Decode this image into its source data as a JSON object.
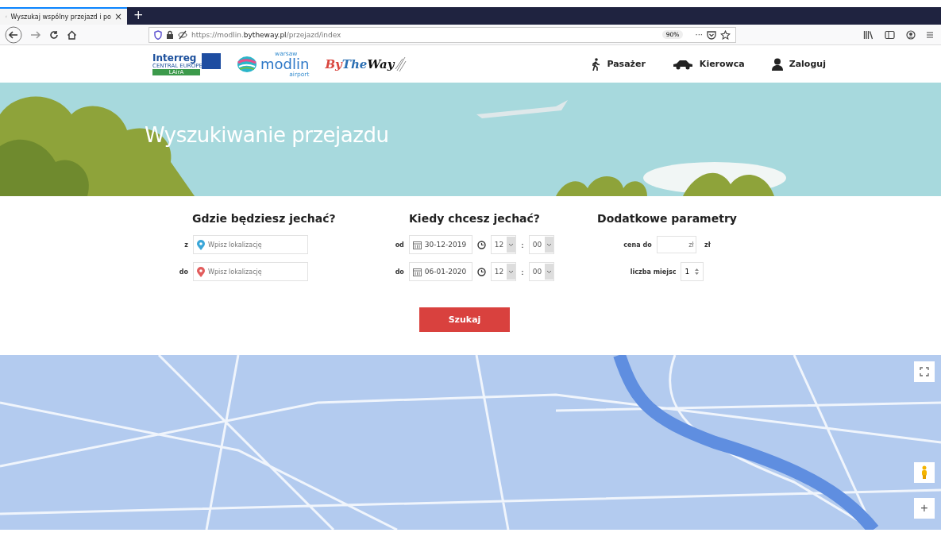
{
  "browser": {
    "tab_title": "Wyszukaj wspólny przejazd i po",
    "tab_close": "×",
    "new_tab": "+",
    "url_prefix": "https://modlin.",
    "url_domain": "bytheway.pl",
    "url_path": "/przejazd/index",
    "zoom": "90%",
    "more": "···"
  },
  "logos": {
    "interreg": "Interreg",
    "interreg_sub": "CENTRAL EUROPE",
    "interreg_project": "LAirA",
    "modlin_top": "warsaw",
    "modlin": "modlin",
    "modlin_sub": "airport",
    "bytheway_1": "By",
    "bytheway_2": "The",
    "bytheway_3": "Way"
  },
  "nav": [
    {
      "kind": "walk",
      "label": "Pasażer"
    },
    {
      "kind": "car",
      "label": "Kierowca"
    },
    {
      "kind": "user",
      "label": "Zaloguj"
    }
  ],
  "hero": {
    "title": "Wyszukiwanie przejazdu"
  },
  "where": {
    "title": "Gdzie będziesz jechać?",
    "rows": [
      {
        "label": "z",
        "color": "#3aa6d8",
        "placeholder": "Wpisz lokalizację"
      },
      {
        "label": "do",
        "color": "#e25c5c",
        "placeholder": "Wpisz lokalizację"
      }
    ]
  },
  "when": {
    "title": "Kiedy chcesz jechać?",
    "rows": [
      {
        "label": "od",
        "date": "30-12-2019",
        "hour": "12",
        "minute": "00",
        "sep": ":"
      },
      {
        "label": "do",
        "date": "06-01-2020",
        "hour": "12",
        "minute": "00",
        "sep": ":"
      }
    ]
  },
  "extra": {
    "title": "Dodatkowe parametry",
    "price_label": "cena do",
    "price_placeholder": "zł",
    "price_unit": "zł",
    "seats_label": "liczba miejsc",
    "seats_value": "1"
  },
  "search_button": "Szukaj",
  "map": {
    "zoom_in": "+"
  }
}
